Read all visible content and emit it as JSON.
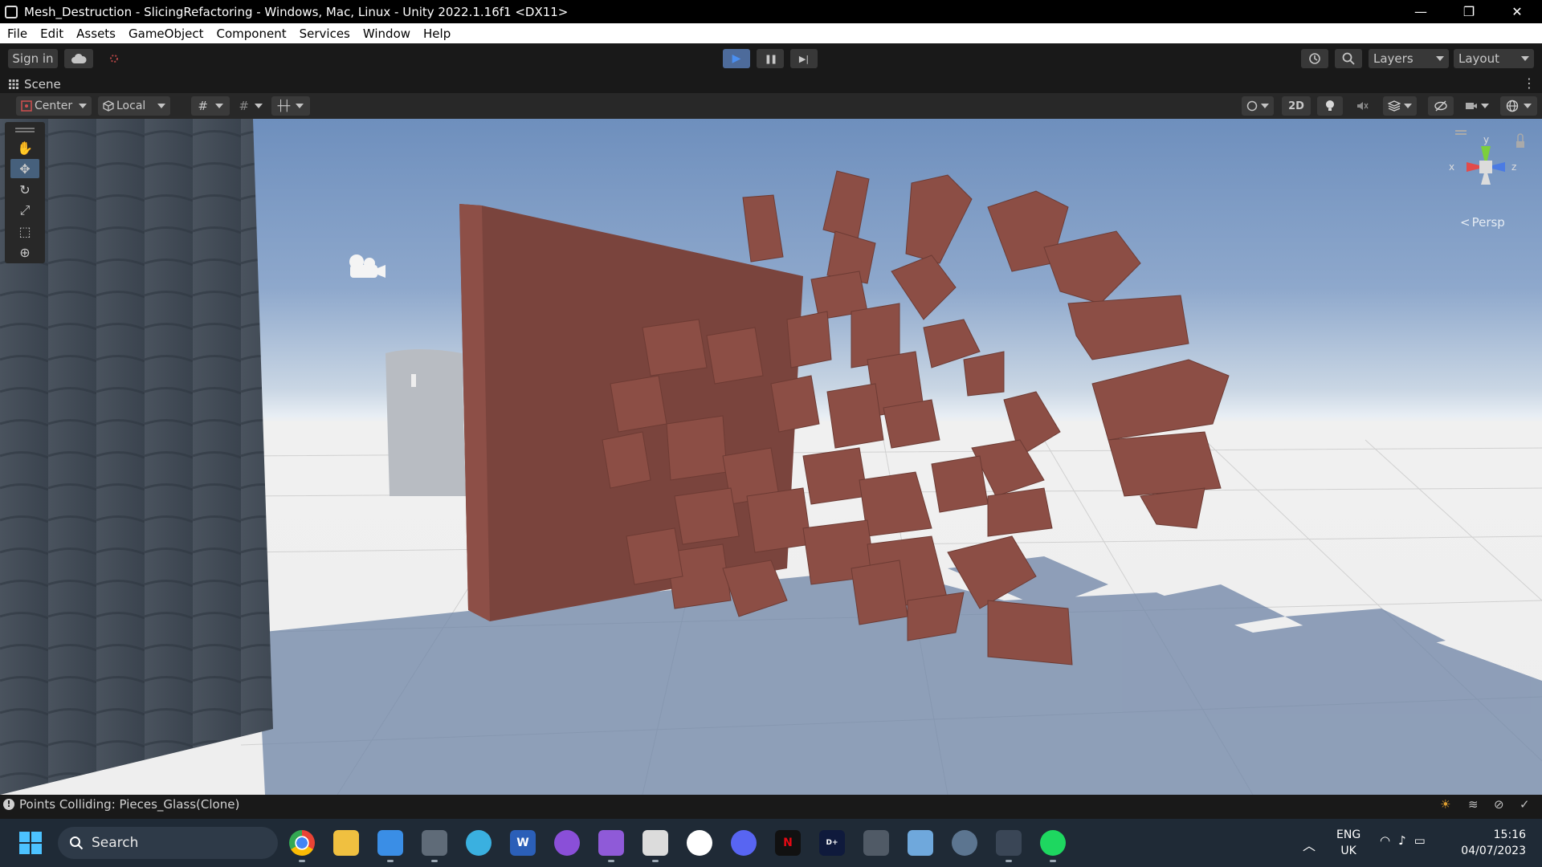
{
  "window": {
    "title": "Mesh_Destruction - SlicingRefactoring - Windows, Mac, Linux - Unity 2022.1.16f1 <DX11>",
    "minimize_glyph": "—",
    "restore_glyph": "❐",
    "close_glyph": "✕"
  },
  "menu": {
    "items": [
      "File",
      "Edit",
      "Assets",
      "GameObject",
      "Component",
      "Services",
      "Window",
      "Help"
    ]
  },
  "toolbar": {
    "sign_in_label": "Sign in",
    "layers_label": "Layers",
    "layout_label": "Layout",
    "play_glyph": "▶",
    "pause_glyph": "❚❚",
    "step_glyph": "▶|"
  },
  "scene": {
    "tab_label": "Scene",
    "pivot_mode": "Center",
    "pivot_rotation": "Local",
    "mode_2d_label": "2D",
    "persp_label": "Persp",
    "gizmo_axes": {
      "x": "x",
      "y": "y",
      "z": "z"
    }
  },
  "status": {
    "message": "Points Colliding: Pieces_Glass(Clone)"
  },
  "taskbar": {
    "search_placeholder": "Search",
    "language": "ENG",
    "region": "UK",
    "time": "15:16",
    "date": "04/07/2023"
  },
  "colors": {
    "accent_play": "#4b8ff0",
    "brick": "#8c4e45",
    "sky_top": "#6e8fbd",
    "ground": "#eeeeee"
  },
  "icons": {
    "taskbar_apps": [
      "chrome-icon",
      "file-explorer-icon",
      "notepad-icon",
      "calculator-icon",
      "paint-icon",
      "word-icon",
      "github-icon",
      "visual-studio-icon",
      "unity-hub-icon",
      "slack-icon",
      "discord-icon",
      "netflix-icon",
      "disney-plus-icon",
      "microphone-icon",
      "photos-icon",
      "settings-icon",
      "unity-icon",
      "spotify-icon"
    ]
  }
}
